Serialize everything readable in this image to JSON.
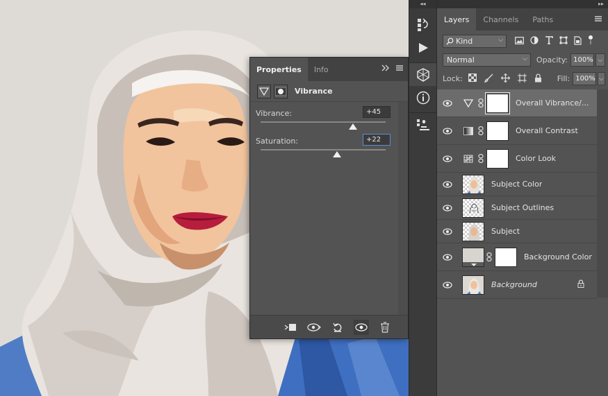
{
  "properties": {
    "tabs": [
      {
        "label": "Properties"
      },
      {
        "label": "Info"
      }
    ],
    "adjustment_title": "Vibrance",
    "vibrance": {
      "label": "Vibrance:",
      "value": "+45",
      "position": 0.74
    },
    "saturation": {
      "label": "Saturation:",
      "value": "+22",
      "position": 0.61
    }
  },
  "layers_panel": {
    "tabs": [
      {
        "label": "Layers"
      },
      {
        "label": "Channels"
      },
      {
        "label": "Paths"
      }
    ],
    "filter_kind": "Kind",
    "blend_mode": "Normal",
    "opacity_label": "Opacity:",
    "opacity_value": "100%",
    "lock_label": "Lock:",
    "fill_label": "Fill:",
    "fill_value": "100%",
    "layers": [
      {
        "name": "Overall Vibrance/...",
        "kind": "vibrance",
        "selected": true
      },
      {
        "name": "Overall Contrast",
        "kind": "levels"
      },
      {
        "name": "Color Look",
        "kind": "lookup"
      },
      {
        "name": "Subject Color",
        "kind": "pixel"
      },
      {
        "name": "Subject Outlines",
        "kind": "pixel"
      },
      {
        "name": "Subject",
        "kind": "pixel"
      },
      {
        "name": "Background Color",
        "kind": "fill"
      },
      {
        "name": "Background",
        "kind": "background",
        "locked": true
      }
    ]
  },
  "colors": {
    "panel_bg": "#535353",
    "tab_bar": "#424242",
    "dock": "#3b3b3b",
    "selected_layer": "#6c6c6c",
    "focus_border": "#5f8bd4"
  }
}
